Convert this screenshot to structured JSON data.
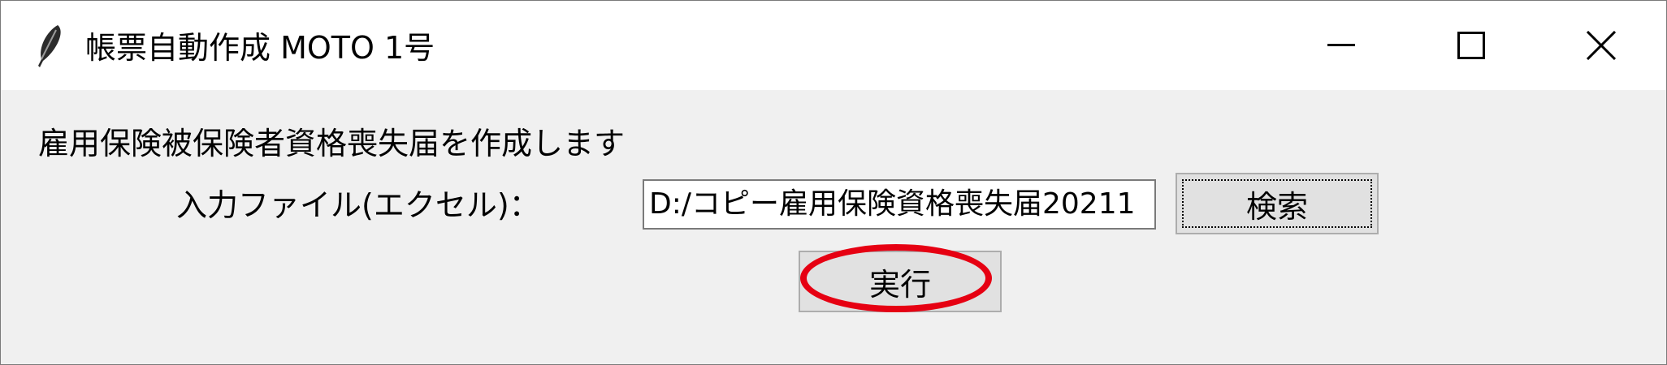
{
  "window": {
    "title": "帳票自動作成 MOTO 1号",
    "app_icon": "feather-icon",
    "controls": {
      "minimize_icon": "minimize-icon",
      "maximize_icon": "maximize-icon",
      "close_icon": "close-icon"
    }
  },
  "main": {
    "description": "雇用保険被保険者資格喪失届を作成します",
    "input_label": "入力ファイル(エクセル)：",
    "file_input_value": "D:/コピー雇用保険資格喪失届20211",
    "search_button_label": "検索",
    "run_button_label": "実行"
  },
  "colors": {
    "highlight": "#e60012",
    "window_bg": "#f0f0f0",
    "button_bg": "#e1e1e1"
  }
}
